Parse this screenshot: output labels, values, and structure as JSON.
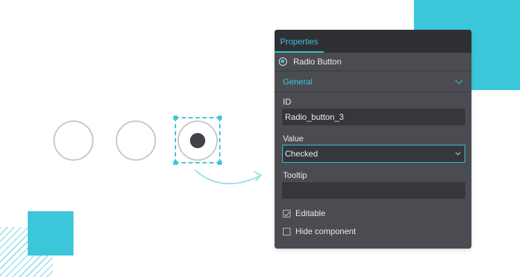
{
  "colors": {
    "accent": "#3bc6da",
    "panel_bg": "#4a4c51",
    "panel_header_bg": "#2e3034",
    "input_bg": "#35373b"
  },
  "canvas": {
    "radio_buttons": [
      {
        "id": "radio-1",
        "checked": false
      },
      {
        "id": "radio-2",
        "checked": false
      },
      {
        "id": "radio-3",
        "checked": true,
        "selected": true
      }
    ]
  },
  "panel": {
    "tab_label": "Properties",
    "component": {
      "icon": "radio-button-icon",
      "label": "Radio Button"
    },
    "section": {
      "label": "General",
      "icon": "chevron-down-icon"
    },
    "fields": {
      "id_label": "ID",
      "id_value": "Radio_button_3",
      "value_label": "Value",
      "value_selected": "Checked",
      "tooltip_label": "Tooltip",
      "tooltip_value": ""
    },
    "checkboxes": [
      {
        "label": "Editable",
        "checked": true
      },
      {
        "label": "Hide component",
        "checked": false
      }
    ]
  }
}
